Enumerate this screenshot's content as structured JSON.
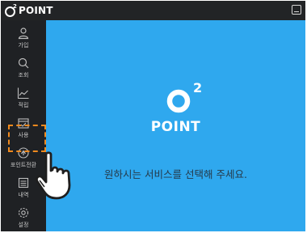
{
  "app": {
    "brand_text": "POINT",
    "brand_superscript": "2"
  },
  "sidebar": {
    "items": [
      {
        "label": "가입",
        "icon": "user-icon"
      },
      {
        "label": "조회",
        "icon": "search-icon"
      },
      {
        "label": "적립",
        "icon": "chart-icon"
      },
      {
        "label": "사용",
        "icon": "calendar-check-icon"
      },
      {
        "label": "포인트전환",
        "icon": "convert-icon"
      },
      {
        "label": "내역",
        "icon": "list-icon"
      },
      {
        "label": "설정",
        "icon": "gear-icon"
      }
    ],
    "highlighted_index": 4
  },
  "main": {
    "logo_text": "POINT",
    "logo_superscript": "2",
    "prompt": "원하시는 서비스를 선택해 주세요."
  },
  "colors": {
    "main_bg": "#2fa8ee",
    "sidebar_bg": "#1f2124",
    "highlight": "#f08a1e"
  }
}
